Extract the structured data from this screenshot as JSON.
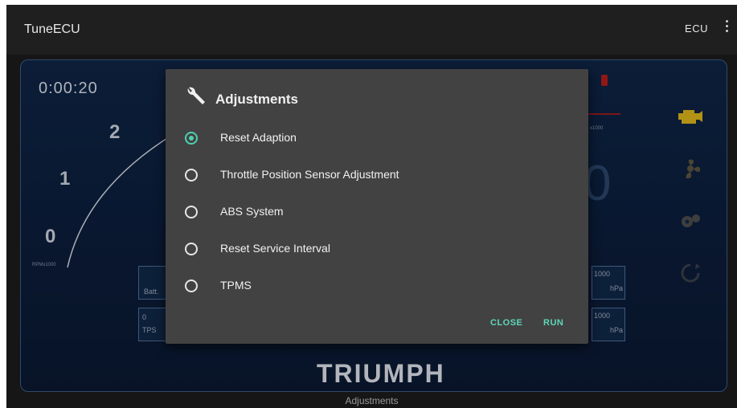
{
  "app": {
    "title": "TuneECU",
    "ecu_label": "ECU"
  },
  "dashboard": {
    "timer": "0:00:20",
    "gauge_labels": [
      "0",
      "1",
      "2"
    ],
    "rpm_unit": "RPMx1000",
    "right_unit": "x1000",
    "big_value": "0",
    "boxes": [
      {
        "label": "Batt.",
        "value": ""
      },
      {
        "label": "TPS",
        "value": "0"
      },
      {
        "label": "hPa",
        "value": "1000"
      },
      {
        "label": "hPa",
        "value": "1000"
      }
    ],
    "brand": "TRIUMPH",
    "bottom_label": "Adjustments"
  },
  "dialog": {
    "title": "Adjustments",
    "icon": "wrench-icon",
    "options": [
      {
        "label": "Reset Adaption",
        "checked": true
      },
      {
        "label": "Throttle Position Sensor Adjustment",
        "checked": false
      },
      {
        "label": "ABS System",
        "checked": false
      },
      {
        "label": "Reset Service Interval",
        "checked": false
      },
      {
        "label": "TPMS",
        "checked": false
      }
    ],
    "close_label": "CLOSE",
    "run_label": "RUN"
  },
  "colors": {
    "accent": "#4fd1b0",
    "dialog_bg": "#424242",
    "dashboard_bg": "#0f2445",
    "warning": "#b11d1d"
  }
}
